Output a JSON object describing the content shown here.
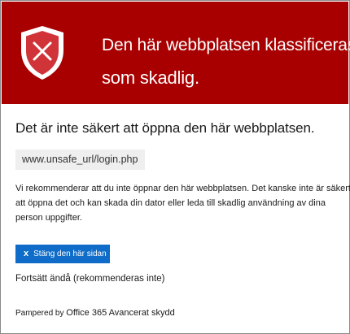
{
  "header": {
    "title_line1": "Den här webbplatsen klassificeras",
    "title_line2": "som skadlig.",
    "icon": "shield-x-icon",
    "background_color": "#a80000"
  },
  "main": {
    "heading": "Det är inte säkert att öppna den här webbplatsen.",
    "url": "www.unsafe_url/login.php",
    "description_lines": [
      "Vi rekommenderar att du inte öppnar den här webbplatsen. Det kanske inte är säkert",
      "att öppna det och kan skada din dator eller leda till skadlig användning av dina",
      "person uppgifter."
    ],
    "close_button": {
      "icon": "x",
      "label": "Stäng den här sidan",
      "color": "#0f6cc8"
    },
    "continue_link": "Fortsätt ändå (rekommenderas inte)"
  },
  "footer": {
    "powered_by": "Pampered by",
    "product": "Office 365 Avancerat skydd"
  }
}
